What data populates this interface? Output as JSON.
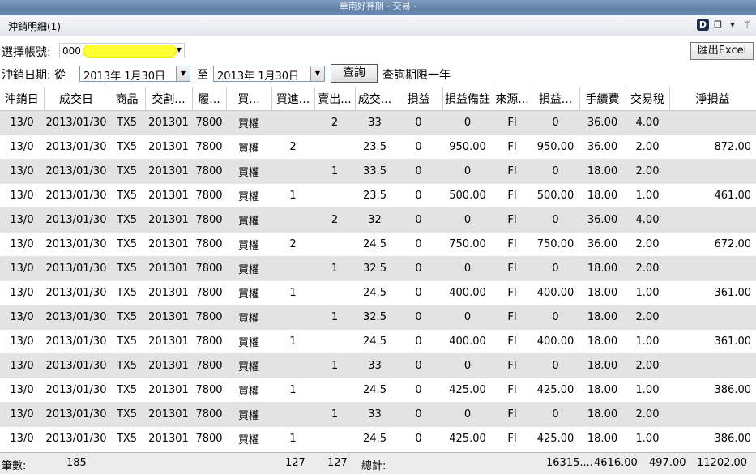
{
  "window": {
    "title": "華南好神期 - 交易 -"
  },
  "panel": {
    "title": "沖銷明細(1)"
  },
  "account": {
    "label": "選擇帳號:",
    "prefix": "000"
  },
  "export_button": "匯出Excel",
  "dates": {
    "label": "沖銷日期: 從",
    "from": "2013年  1月30日",
    "to_label": "至",
    "to": "2013年  1月30日",
    "query_button": "查詢",
    "limit_note": "查詢期限一年"
  },
  "columns": [
    "沖銷日",
    "成交日",
    "商品",
    "交割...",
    "履...",
    "買...",
    "買進...",
    "賣出...",
    "成交...",
    "損益",
    "損益備註",
    "來源...",
    "損益...",
    "手續費",
    "交易稅",
    "淨損益"
  ],
  "rows": [
    [
      "13/0",
      "2013/01/30",
      "TX5",
      "201301",
      "7800",
      "買權",
      "",
      "2",
      "33",
      "0",
      "0",
      "FI",
      "0",
      "36.00",
      "4.00",
      ""
    ],
    [
      "13/0",
      "2013/01/30",
      "TX5",
      "201301",
      "7800",
      "買權",
      "2",
      "",
      "23.5",
      "0",
      "950.00",
      "FI",
      "950.00",
      "36.00",
      "2.00",
      "872.00"
    ],
    [
      "13/0",
      "2013/01/30",
      "TX5",
      "201301",
      "7800",
      "買權",
      "",
      "1",
      "33.5",
      "0",
      "0",
      "FI",
      "0",
      "18.00",
      "2.00",
      ""
    ],
    [
      "13/0",
      "2013/01/30",
      "TX5",
      "201301",
      "7800",
      "買權",
      "1",
      "",
      "23.5",
      "0",
      "500.00",
      "FI",
      "500.00",
      "18.00",
      "1.00",
      "461.00"
    ],
    [
      "13/0",
      "2013/01/30",
      "TX5",
      "201301",
      "7800",
      "買權",
      "",
      "2",
      "32",
      "0",
      "0",
      "FI",
      "0",
      "36.00",
      "4.00",
      ""
    ],
    [
      "13/0",
      "2013/01/30",
      "TX5",
      "201301",
      "7800",
      "買權",
      "2",
      "",
      "24.5",
      "0",
      "750.00",
      "FI",
      "750.00",
      "36.00",
      "2.00",
      "672.00"
    ],
    [
      "13/0",
      "2013/01/30",
      "TX5",
      "201301",
      "7800",
      "買權",
      "",
      "1",
      "32.5",
      "0",
      "0",
      "FI",
      "0",
      "18.00",
      "2.00",
      ""
    ],
    [
      "13/0",
      "2013/01/30",
      "TX5",
      "201301",
      "7800",
      "買權",
      "1",
      "",
      "24.5",
      "0",
      "400.00",
      "FI",
      "400.00",
      "18.00",
      "1.00",
      "361.00"
    ],
    [
      "13/0",
      "2013/01/30",
      "TX5",
      "201301",
      "7800",
      "買權",
      "",
      "1",
      "32.5",
      "0",
      "0",
      "FI",
      "0",
      "18.00",
      "2.00",
      ""
    ],
    [
      "13/0",
      "2013/01/30",
      "TX5",
      "201301",
      "7800",
      "買權",
      "1",
      "",
      "24.5",
      "0",
      "400.00",
      "FI",
      "400.00",
      "18.00",
      "1.00",
      "361.00"
    ],
    [
      "13/0",
      "2013/01/30",
      "TX5",
      "201301",
      "7800",
      "買權",
      "",
      "1",
      "33",
      "0",
      "0",
      "FI",
      "0",
      "18.00",
      "2.00",
      ""
    ],
    [
      "13/0",
      "2013/01/30",
      "TX5",
      "201301",
      "7800",
      "買權",
      "1",
      "",
      "24.5",
      "0",
      "425.00",
      "FI",
      "425.00",
      "18.00",
      "1.00",
      "386.00"
    ],
    [
      "13/0",
      "2013/01/30",
      "TX5",
      "201301",
      "7800",
      "買權",
      "",
      "1",
      "33",
      "0",
      "0",
      "FI",
      "0",
      "18.00",
      "2.00",
      ""
    ],
    [
      "13/0",
      "2013/01/30",
      "TX5",
      "201301",
      "7800",
      "買權",
      "1",
      "",
      "24.5",
      "0",
      "425.00",
      "FI",
      "425.00",
      "18.00",
      "1.00",
      "386.00"
    ]
  ],
  "footer": {
    "count_label": "筆數:",
    "count": "185",
    "buy_total": "127",
    "sell_total": "127",
    "total_label": "總計:",
    "pnl_total": "16315....",
    "fee_total": "4616.00",
    "tax_total": "497.00",
    "net_total": "11202.00"
  },
  "colors": {
    "highlight_mask": "#ffff33",
    "row_alt": "#e3e3e3",
    "titlebar": "#6d8bb1"
  },
  "icons": [
    "d-logo-icon",
    "float-window-icon",
    "dropdown-icon",
    "pin-icon"
  ]
}
